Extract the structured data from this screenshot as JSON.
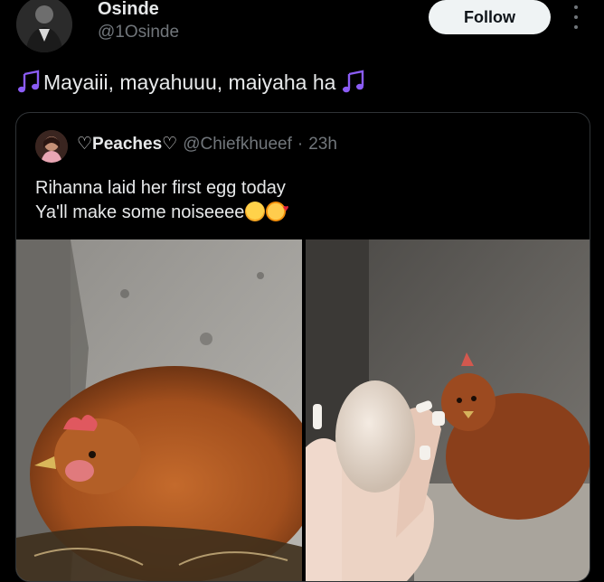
{
  "author": {
    "display_name": "Osinde",
    "handle": "@1Osinde"
  },
  "actions": {
    "follow_label": "Follow"
  },
  "tweet": {
    "text": "Mayaiii, mayahuuu, maiyaha ha",
    "icons": [
      "musical-notes-icon",
      "musical-notes-icon"
    ]
  },
  "quoted": {
    "display_name": "♡Peaches♡",
    "handle": "@Chiefkhueef",
    "separator": "·",
    "time": "23h",
    "text_line1": "Rihanna laid her first egg today",
    "text_line2": "Ya'll make some noiseeee",
    "text_emojis": [
      "relieved-face-icon",
      "smiling-face-with-hearts-icon"
    ],
    "media": [
      {
        "alt_icon": "hen-in-nest-photo"
      },
      {
        "alt_icon": "hand-holding-egg-photo"
      }
    ]
  },
  "colors": {
    "background": "#000000",
    "text_primary": "#e7e9ea",
    "text_secondary": "#71767b",
    "border": "#2f3336",
    "follow_bg": "#eff3f4",
    "note_purple": "#8b5cf6"
  }
}
